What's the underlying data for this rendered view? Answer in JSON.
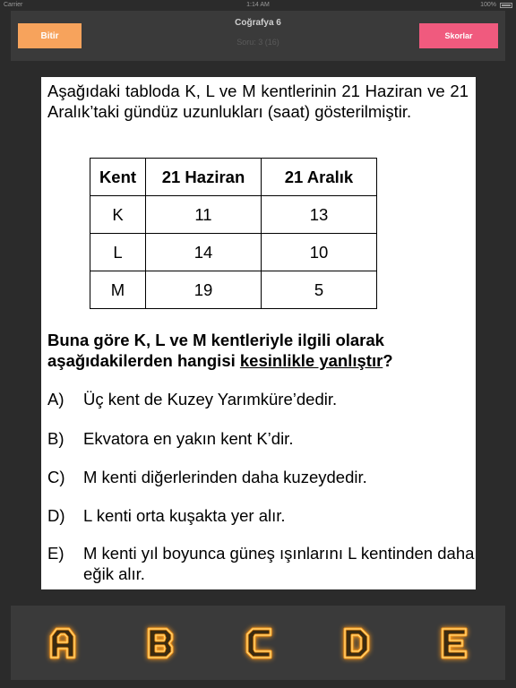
{
  "status_bar": {
    "carrier": "Carrier",
    "time": "1:14 AM",
    "battery": "100%"
  },
  "header": {
    "finish_label": "Bitir",
    "title": "Coğrafya 6",
    "question_counter": "Soru: 3 (16)",
    "scores_label": "Skorlar"
  },
  "question": {
    "intro": "Aşağıdaki tabloda K, L ve M kentlerinin 21 Haziran ve 21 Aralık’taki gündüz uzunlukları (saat) gösterilmiştir.",
    "table": {
      "headers": [
        "Kent",
        "21 Haziran",
        "21 Aralık"
      ],
      "rows": [
        [
          "K",
          "11",
          "13"
        ],
        [
          "L",
          "14",
          "10"
        ],
        [
          "M",
          "19",
          "5"
        ]
      ]
    },
    "stem_before": "Buna göre K, L ve M kentleriyle ilgili olarak aşağıdakilerden hangisi ",
    "stem_emphasis": "kesinlikle yanlıştır",
    "stem_after": "?",
    "options": [
      {
        "letter": "A)",
        "text": "Üç kent de Kuzey Yarımküre’dedir."
      },
      {
        "letter": "B)",
        "text": "Ekvatora en yakın kent K’dir."
      },
      {
        "letter": "C)",
        "text": "M kenti diğerlerinden daha kuzeydedir."
      },
      {
        "letter": "D)",
        "text": "L kenti orta kuşakta yer alır."
      },
      {
        "letter": "E)",
        "text": "M kenti yıl boyunca güneş ışınlarını L kentinden daha eğik alır."
      }
    ]
  },
  "answer_buttons": {
    "letters": [
      "A",
      "B",
      "C",
      "D",
      "E"
    ],
    "glow_color": "#ff9b1a",
    "fill_color": "#3a2a10"
  }
}
